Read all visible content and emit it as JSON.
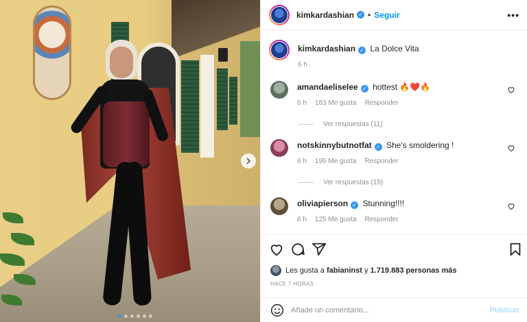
{
  "post": {
    "username": "kimkardashian",
    "follow_label": "Seguir",
    "separator": "•",
    "more_label": "•••",
    "caption_text": "La Dolce Vita",
    "caption_time": "6 h",
    "carousel": {
      "total": 6,
      "active_index": 0
    }
  },
  "comments": [
    {
      "username": "amandaeliselee",
      "text": "hottest 🔥❤️🔥",
      "time": "6 h",
      "likes": "183 Me gusta",
      "reply_label": "Responder",
      "view_replies": "Ver respuestas (11)"
    },
    {
      "username": "notskinnybutnotfat",
      "text": "She's smoldering !",
      "time": "6 h",
      "likes": "195 Me gusta",
      "reply_label": "Responder",
      "view_replies": "Ver respuestas (15)"
    },
    {
      "username": "oliviapierson",
      "text": "Stunning!!!!",
      "time": "6 h",
      "likes": "125 Me gusta",
      "reply_label": "Responder"
    }
  ],
  "likes": {
    "prefix": "Les gusta a",
    "user": "fabianinst",
    "connector": "y",
    "others": "1.719.883 personas más"
  },
  "post_time": "HACE 7 HORAS",
  "comment_box": {
    "placeholder": "Añade un comentario...",
    "publish_label": "Publicar"
  },
  "colors": {
    "link_blue": "#0095f6",
    "verified_blue": "#3897f0",
    "muted": "#8e8e8e",
    "publish_disabled": "#b2dffc"
  },
  "icons": [
    "verified-icon",
    "more-icon",
    "chevron-right-icon",
    "heart-icon",
    "comment-icon",
    "share-icon",
    "bookmark-icon",
    "emoji-icon"
  ]
}
